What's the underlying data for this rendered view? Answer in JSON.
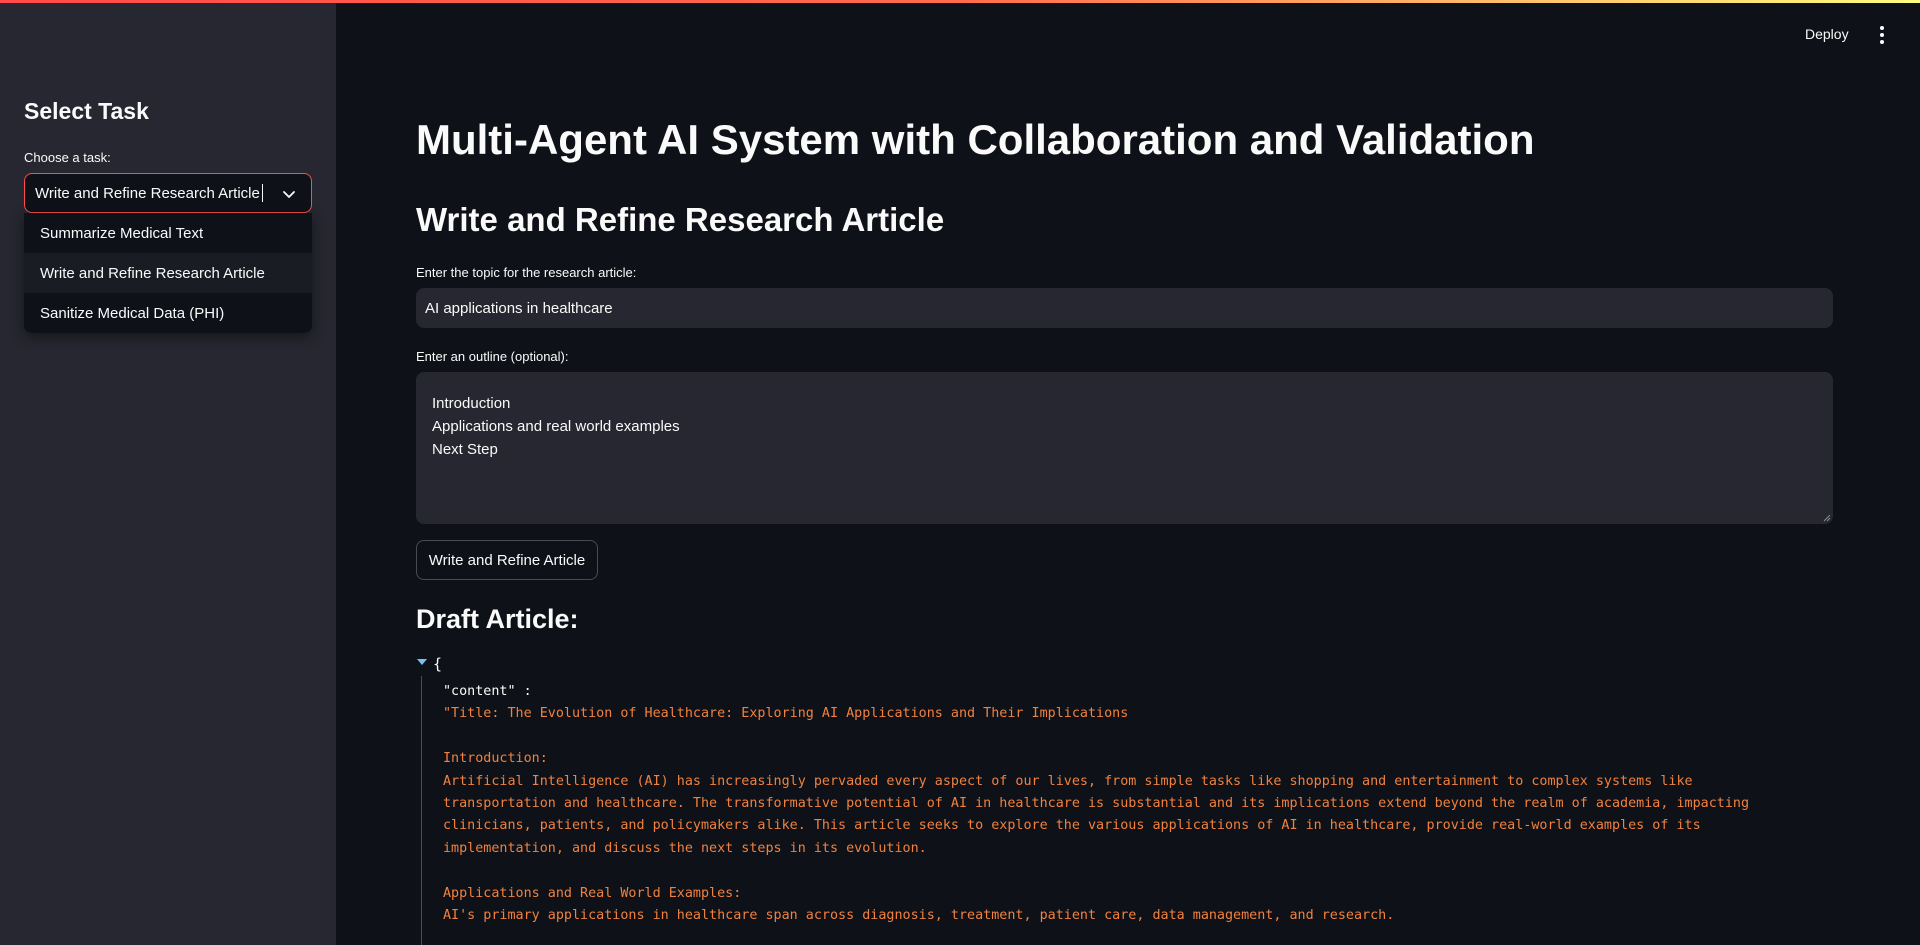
{
  "sidebar": {
    "title": "Select Task",
    "select_label": "Choose a task:",
    "selected_value": "Write and Refine Research Article",
    "options": [
      "Summarize Medical Text",
      "Write and Refine Research Article",
      "Sanitize Medical Data (PHI)"
    ]
  },
  "header": {
    "deploy_label": "Deploy",
    "menu_icon": "kebab-icon"
  },
  "main": {
    "title": "Multi-Agent AI System with Collaboration and Validation",
    "section_title": "Write and Refine Research Article",
    "topic_label": "Enter the topic for the research article:",
    "topic_value": "AI applications in healthcare",
    "outline_label": "Enter an outline (optional):",
    "outline_lines": [
      "Introduction",
      "Applications and real world examples",
      "Next Step"
    ],
    "button_label": "Write and Refine Article",
    "draft_title": "Draft Article:",
    "json": {
      "open_brace": "{",
      "key": "\"content\" :",
      "lines": [
        "\"Title: The Evolution of Healthcare: Exploring AI Applications and Their Implications",
        "",
        "Introduction:",
        "Artificial Intelligence (AI) has increasingly pervaded every aspect of our lives, from simple tasks like shopping and entertainment to complex systems like",
        "transportation and healthcare. The transformative potential of AI in healthcare is substantial and its implications extend beyond the realm of academia, impacting",
        "clinicians, patients, and policymakers alike. This article seeks to explore the various applications of AI in healthcare, provide real-world examples of its",
        "implementation, and discuss the next steps in its evolution.",
        "",
        "Applications and Real World Examples:",
        "AI's primary applications in healthcare span across diagnosis, treatment, patient care, data management, and research."
      ]
    }
  },
  "colors": {
    "accent": "#ff4b4b",
    "background": "#0e1117",
    "sidebar": "#262730",
    "json_string": "#f0813f",
    "json_toggle": "#78c0f0"
  }
}
